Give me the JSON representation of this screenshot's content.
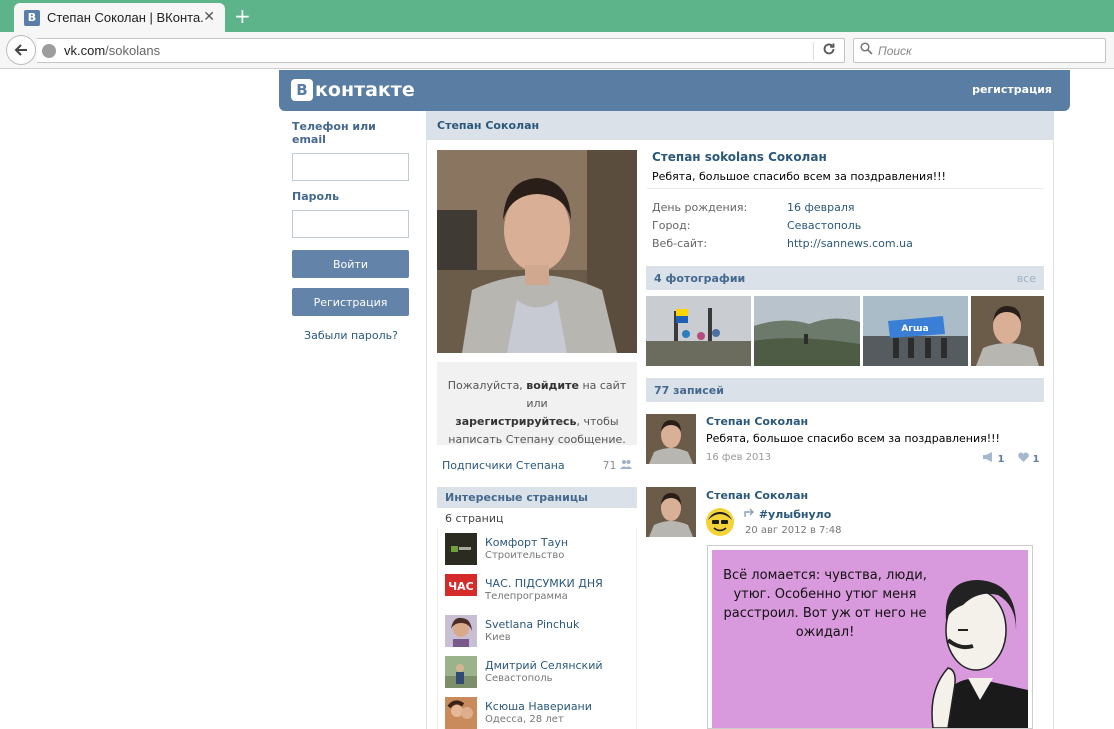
{
  "browser": {
    "tab_title": "Степан Соколан | ВКонта...",
    "favicon_letter": "B",
    "new_tab": "+",
    "close": "✕",
    "url_domain": "vk.com",
    "url_path": "/sokolans",
    "search_placeholder": "Поиск"
  },
  "header": {
    "logo_letter": "B",
    "logo_text": "контакте",
    "register_link": "регистрация"
  },
  "login": {
    "phone_label": "Телефон или email",
    "password_label": "Пароль",
    "login_button": "Войти",
    "register_button": "Регистрация",
    "forgot_link": "Забыли пароль?"
  },
  "profile": {
    "page_title": "Степан Соколан",
    "full_name": "Степан sokolans Соколан",
    "status": "Ребята, большое спасибо всем за поздравления!!!",
    "info": [
      {
        "label": "День рождения:",
        "value": "16 февраля"
      },
      {
        "label": "Город:",
        "value": "Севастополь"
      },
      {
        "label": "Веб-сайт:",
        "value": "http://sannews.com.ua"
      }
    ],
    "message_prefix": "Пожалуйста, ",
    "message_login": "войдите",
    "message_mid": " на сайт или ",
    "message_register": "зарегистрируйтесь",
    "message_suffix": ", чтобы написать Степану сообщение.",
    "subscribers_label": "Подписчики Степана",
    "subscribers_count": "71"
  },
  "pages": {
    "title": "Интересные страницы",
    "count": "6 страниц",
    "items": [
      {
        "name": "Комфорт Таун",
        "sub": "Строительство"
      },
      {
        "name": "ЧАС. ПІДСУМКИ ДНЯ",
        "sub": "Телепрограмма"
      },
      {
        "name": "Svetlana Pinchuk",
        "sub": "Киев"
      },
      {
        "name": "Дмитрий Селянский",
        "sub": "Севастополь"
      },
      {
        "name": "Ксюша Навериани",
        "sub": "Одесса, 28 лет"
      }
    ]
  },
  "photos": {
    "title": "4 фотографии",
    "all": "все"
  },
  "wall": {
    "title": "77 записей",
    "posts": [
      {
        "author": "Степан Соколан",
        "text": "Ребята, большое спасибо всем за поздравления!!!",
        "date": "16 фев 2013",
        "shares": "1",
        "likes": "1"
      },
      {
        "author": "Степан Соколан",
        "repost_name": "#улыбнуло",
        "repost_date": "20 авг 2012 в 7:48",
        "meme_text": "Всё ломается: чувства, люди, утюг. Особенно утюг меня расстроил. Вот уж от него не ожидал!"
      }
    ]
  }
}
